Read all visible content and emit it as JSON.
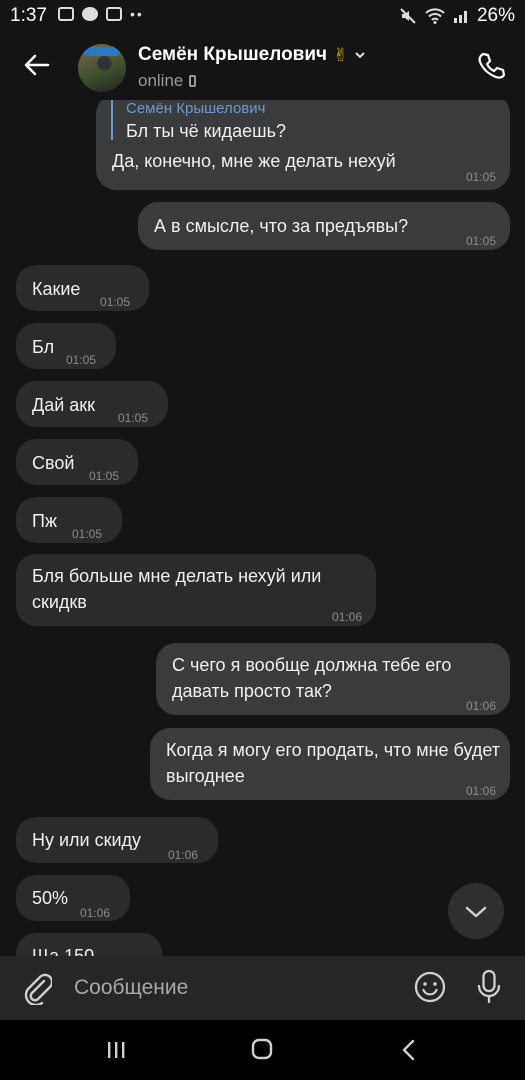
{
  "status_bar": {
    "time": "1:37",
    "battery": "26%"
  },
  "header": {
    "contact_name": "Семён Крышелович",
    "emoji": "✌",
    "presence": "online"
  },
  "messages": [
    {
      "direction": "out",
      "reply_to_name": "Семён Крышелович",
      "reply_to_text": "Бл ты чё кидаешь?",
      "text": "Да, конечно, мне же делать нехуй",
      "time": "01:05"
    },
    {
      "direction": "out",
      "text": "А в смысле, что за предъявы?",
      "time": "01:05"
    },
    {
      "direction": "in",
      "text": "Какие",
      "time": "01:05"
    },
    {
      "direction": "in",
      "text": "Бл",
      "time": "01:05"
    },
    {
      "direction": "in",
      "text": "Дай акк",
      "time": "01:05"
    },
    {
      "direction": "in",
      "text": "Свой",
      "time": "01:05"
    },
    {
      "direction": "in",
      "text": "Пж",
      "time": "01:05"
    },
    {
      "direction": "in",
      "text": "Бля больше мне делать нехуй или скидкв",
      "time": "01:06"
    },
    {
      "direction": "out",
      "text": "С чего я вообще должна тебе его давать просто так?",
      "time": "01:06"
    },
    {
      "direction": "out",
      "text": "Когда я могу его продать, что мне будет выгоднее",
      "time": "01:06"
    },
    {
      "direction": "in",
      "text": "Ну или скиду",
      "time": "01:06"
    },
    {
      "direction": "in",
      "text": "50%",
      "time": "01:06"
    },
    {
      "direction": "in",
      "text": "Ща 150",
      "time": ""
    }
  ],
  "composer": {
    "placeholder": "Сообщение"
  }
}
